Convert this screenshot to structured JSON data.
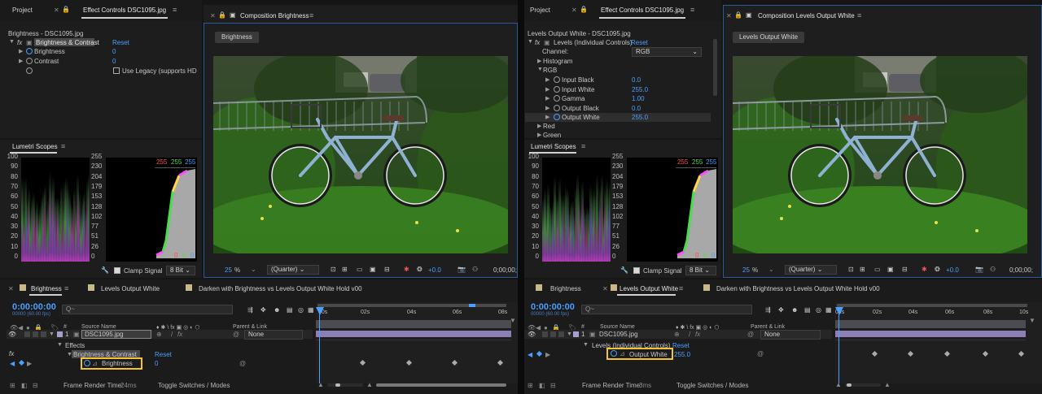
{
  "left": {
    "project_tab": "Project",
    "effect_controls_tab": "Effect Controls DSC1095.jpg",
    "composition_tab": "Composition Brightness",
    "breadcrumb": "Brightness - DSC1095.jpg",
    "fx": "fx",
    "effect_name": "Brightness & Contrast",
    "reset": "Reset",
    "params": [
      {
        "label": "Brightness",
        "value": "0"
      },
      {
        "label": "Contrast",
        "value": "0"
      }
    ],
    "legacy_label": "Use Legacy (supports HD",
    "viewer_button": "Brightness",
    "lumetri_tab": "Lumetri Scopes",
    "scope_left_ticks": [
      "100",
      "90",
      "80",
      "70",
      "60",
      "50",
      "40",
      "30",
      "20",
      "10",
      "0"
    ],
    "scope_right_ticks": [
      "255",
      "230",
      "204",
      "179",
      "153",
      "128",
      "102",
      "77",
      "51",
      "26",
      "0"
    ],
    "rgb_top": [
      "255",
      "255",
      "255"
    ],
    "rgb_bottom": [
      "0",
      "0",
      "0"
    ],
    "clamp_label": "Clamp Signal",
    "bit_depth": "8 Bit",
    "zoom": "25",
    "zoom_unit": "%",
    "resolution": "(Quarter)",
    "exposure": "+0.0",
    "time_right": "0;00;00;",
    "timeline_tabs": [
      "Brightness",
      "Levels Output White",
      "Darken with Brightness vs Levels Output White Hold v00"
    ],
    "timecode": "0:00:00:00",
    "timecode_fps": "00000 (60.00 fps)",
    "search_placeholder": "Q~",
    "col_hash": "#",
    "col_source": "Source Name",
    "col_parent": "Parent & Link",
    "layer_num": "1",
    "layer_name": "DSC1095.jpg",
    "parent_value": "None",
    "effects_label": "Effects",
    "layer_effect": "Brightness & Contrast",
    "layer_reset": "Reset",
    "property": "Brightness",
    "property_value": "0",
    "ruler": [
      "00s",
      "02s",
      "04s",
      "06s",
      "08s"
    ],
    "render_time_label": "Frame Render Time:",
    "render_time_value": "24ms",
    "toggle_label": "Toggle Switches / Modes"
  },
  "right": {
    "project_tab": "Project",
    "effect_controls_tab": "Effect Controls DSC1095.jpg",
    "composition_tab": "Composition Levels Output White",
    "breadcrumb": "Levels Output White - DSC1095.jpg",
    "fx": "fx",
    "effect_name": "Levels (Individual Controls)",
    "reset": "Reset",
    "channel_label": "Channel:",
    "channel_value": "RGB",
    "histogram_label": "Histogram",
    "rgb_group": "RGB",
    "params": [
      {
        "label": "Input Black",
        "value": "0.0"
      },
      {
        "label": "Input White",
        "value": "255.0"
      },
      {
        "label": "Gamma",
        "value": "1.00"
      },
      {
        "label": "Output Black",
        "value": "0.0"
      },
      {
        "label": "Output White",
        "value": "255.0"
      }
    ],
    "red_label": "Red",
    "green_label": "Green",
    "viewer_button": "Levels Output White",
    "lumetri_tab": "Lumetri Scopes",
    "scope_left_ticks": [
      "100",
      "90",
      "80",
      "70",
      "60",
      "50",
      "40",
      "30",
      "20",
      "10",
      "0"
    ],
    "scope_right_ticks": [
      "255",
      "230",
      "204",
      "179",
      "153",
      "128",
      "102",
      "77",
      "51",
      "26",
      "0"
    ],
    "rgb_top": [
      "255",
      "255",
      "255"
    ],
    "rgb_bottom": [
      "0",
      "0",
      "0"
    ],
    "clamp_label": "Clamp Signal",
    "bit_depth": "8 Bit",
    "zoom": "25",
    "zoom_unit": "%",
    "resolution": "(Quarter)",
    "exposure": "+0.0",
    "time_right": "0;00;00;",
    "timeline_tabs": [
      "Brightness",
      "Levels Output White",
      "Darken with Brightness vs Levels Output White Hold v00"
    ],
    "timecode": "0:00:00:00",
    "timecode_fps": "00000 (60.00 fps)",
    "search_placeholder": "Q~",
    "col_hash": "#",
    "col_source": "Source Name",
    "col_parent": "Parent & Link",
    "layer_num": "1",
    "layer_name": "DSC1095.jpg",
    "parent_value": "None",
    "layer_effect": "Levels (Individual Controls)",
    "layer_reset": "Reset",
    "property": "Output White",
    "property_value": "255.0",
    "ruler": [
      "00s",
      "02s",
      "04s",
      "06s",
      "08s",
      "10s"
    ],
    "render_time_label": "Frame Render Time:",
    "render_time_value": "3ms",
    "toggle_label": "Toggle Switches / Modes"
  },
  "colors": {
    "accent_blue": "#4a9fff",
    "highlight_yellow": "#f4c430",
    "track_purple": "#8c7fb6"
  }
}
